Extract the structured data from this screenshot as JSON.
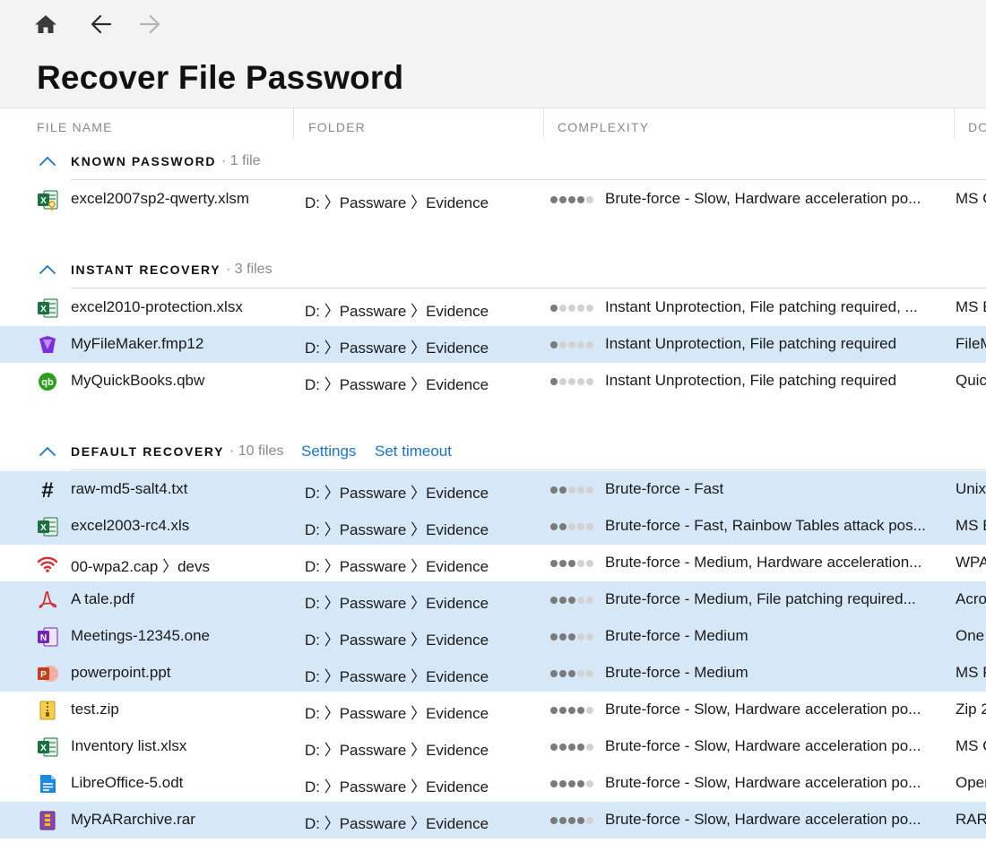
{
  "header": {
    "title": "Recover File Password",
    "nav": {
      "home_icon": "home-icon",
      "back_icon": "arrow-left-icon",
      "forward_icon": "arrow-right-icon"
    }
  },
  "columns": [
    "FILE NAME",
    "FOLDER",
    "COMPLEXITY",
    "DO"
  ],
  "colors": {
    "accent": "#1a73c8",
    "selection": "#d6e7f7",
    "header_bg": "#f3f3f3"
  },
  "groups": [
    {
      "title": "KNOWN PASSWORD",
      "count": "· 1 file",
      "links": [],
      "rows": [
        {
          "icon": "excel-key-icon",
          "name": "excel2007sp2-qwerty.xlsm",
          "folder": "D: 〉Passware 〉Evidence",
          "level": 4,
          "complexity": "Brute-force - Slow, Hardware acceleration po...",
          "doc": "MS O",
          "selected": false
        }
      ]
    },
    {
      "title": "INSTANT RECOVERY",
      "count": "· 3 files",
      "links": [],
      "rows": [
        {
          "icon": "excel-icon",
          "name": "excel2010-protection.xlsx",
          "folder": "D: 〉Passware 〉Evidence",
          "level": 1,
          "complexity": "Instant Unprotection, File patching required, ...",
          "doc": "MS E",
          "selected": false
        },
        {
          "icon": "filemaker-icon",
          "name": "MyFileMaker.fmp12",
          "folder": "D: 〉Passware 〉Evidence",
          "level": 1,
          "complexity": "Instant Unprotection, File patching required",
          "doc": "FileM",
          "selected": true
        },
        {
          "icon": "quickbooks-icon",
          "name": "MyQuickBooks.qbw",
          "folder": "D: 〉Passware 〉Evidence",
          "level": 1,
          "complexity": "Instant Unprotection, File patching required",
          "doc": "Quic",
          "selected": false
        }
      ]
    },
    {
      "title": "DEFAULT RECOVERY",
      "count": "· 10 files",
      "links": [
        "Settings",
        "Set timeout"
      ],
      "rows": [
        {
          "icon": "hash-icon",
          "name": "raw-md5-salt4.txt",
          "folder": "D: 〉Passware 〉Evidence",
          "level": 2,
          "complexity": "Brute-force - Fast",
          "doc": "Unix",
          "selected": true
        },
        {
          "icon": "excel-icon",
          "name": "excel2003-rc4.xls",
          "folder": "D: 〉Passware 〉Evidence",
          "level": 2,
          "complexity": "Brute-force - Fast, Rainbow Tables attack pos...",
          "doc": "MS E",
          "selected": true
        },
        {
          "icon": "wifi-icon",
          "name": "00-wpa2.cap 〉devs",
          "folder": "D: 〉Passware 〉Evidence",
          "level": 3,
          "complexity": "Brute-force - Medium, Hardware acceleration...",
          "doc": "WPA",
          "selected": false
        },
        {
          "icon": "pdf-icon",
          "name": "A tale.pdf",
          "folder": "D: 〉Passware 〉Evidence",
          "level": 3,
          "complexity": "Brute-force - Medium, File patching required...",
          "doc": "Acro",
          "selected": true
        },
        {
          "icon": "onenote-icon",
          "name": "Meetings-12345.one",
          "folder": "D: 〉Passware 〉Evidence",
          "level": 3,
          "complexity": "Brute-force - Medium",
          "doc": "One",
          "selected": true
        },
        {
          "icon": "powerpoint-icon",
          "name": "powerpoint.ppt",
          "folder": "D: 〉Passware 〉Evidence",
          "level": 3,
          "complexity": "Brute-force - Medium",
          "doc": "MS P",
          "selected": true
        },
        {
          "icon": "zip-icon",
          "name": "test.zip",
          "folder": "D: 〉Passware 〉Evidence",
          "level": 4,
          "complexity": "Brute-force - Slow, Hardware acceleration po...",
          "doc": "Zip 2",
          "selected": false
        },
        {
          "icon": "excel-icon",
          "name": "Inventory list.xlsx",
          "folder": "D: 〉Passware 〉Evidence",
          "level": 4,
          "complexity": "Brute-force - Slow, Hardware acceleration po...",
          "doc": "MS O",
          "selected": false
        },
        {
          "icon": "libreoffice-icon",
          "name": "LibreOffice-5.odt",
          "folder": "D: 〉Passware 〉Evidence",
          "level": 4,
          "complexity": "Brute-force - Slow, Hardware acceleration po...",
          "doc": "Oper",
          "selected": false
        },
        {
          "icon": "rar-icon",
          "name": "MyRARarchive.rar",
          "folder": "D: 〉Passware 〉Evidence",
          "level": 4,
          "complexity": "Brute-force - Slow, Hardware acceleration po...",
          "doc": "RAR",
          "selected": true
        }
      ]
    }
  ]
}
